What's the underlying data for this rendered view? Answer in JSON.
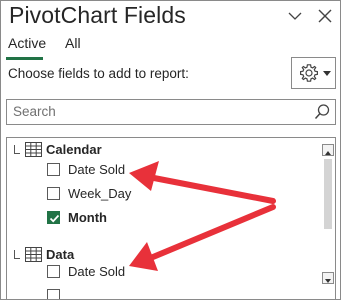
{
  "panel": {
    "title": "PivotChart Fields",
    "collapse_icon": "chevron-down-icon",
    "close_icon": "close-icon"
  },
  "tabs": [
    {
      "label": "Active",
      "active": true
    },
    {
      "label": "All",
      "active": false
    }
  ],
  "choose_label": "Choose fields to add to report:",
  "tools": {
    "icon": "gear-icon",
    "dropdown_icon": "caret-down-icon"
  },
  "search": {
    "placeholder": "Search",
    "icon": "search-icon"
  },
  "tables": [
    {
      "name": "Calendar",
      "icon": "table-icon",
      "fields": [
        {
          "label": "Date Sold",
          "checked": false
        },
        {
          "label": "Week_Day",
          "checked": false
        },
        {
          "label": "Month",
          "checked": true
        }
      ]
    },
    {
      "name": "Data",
      "icon": "table-icon",
      "fields": [
        {
          "label": "Date Sold",
          "checked": false
        }
      ]
    }
  ],
  "colors": {
    "accent": "#217346",
    "annotation_arrow": "#e8313a",
    "text": "#262626",
    "border": "#8a8a8a"
  }
}
